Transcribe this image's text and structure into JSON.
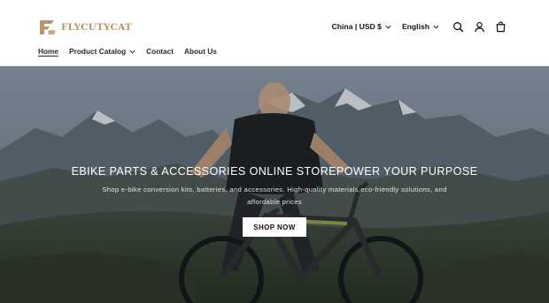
{
  "header": {
    "logo_text": "FLYCUTYCAT",
    "country_currency": "China | USD $",
    "language": "English",
    "icons": [
      "search-icon",
      "account-icon",
      "cart-icon"
    ]
  },
  "nav": {
    "items": [
      {
        "label": "Home"
      },
      {
        "label": "Product Catalog"
      },
      {
        "label": "Contact"
      },
      {
        "label": "About Us"
      }
    ]
  },
  "hero": {
    "title": "EBIKE PARTS & ACCESSORIES ONLINE STOREPOWER YOUR PURPOSE",
    "subtitle": "Shop e-bike conversion kits, batteries, and accessories. High-quality materials,eco-friendly solutions, and affordable prices",
    "button_label": "SHOP NOW"
  },
  "colors": {
    "logo": "#b89669",
    "text": "#121212"
  }
}
